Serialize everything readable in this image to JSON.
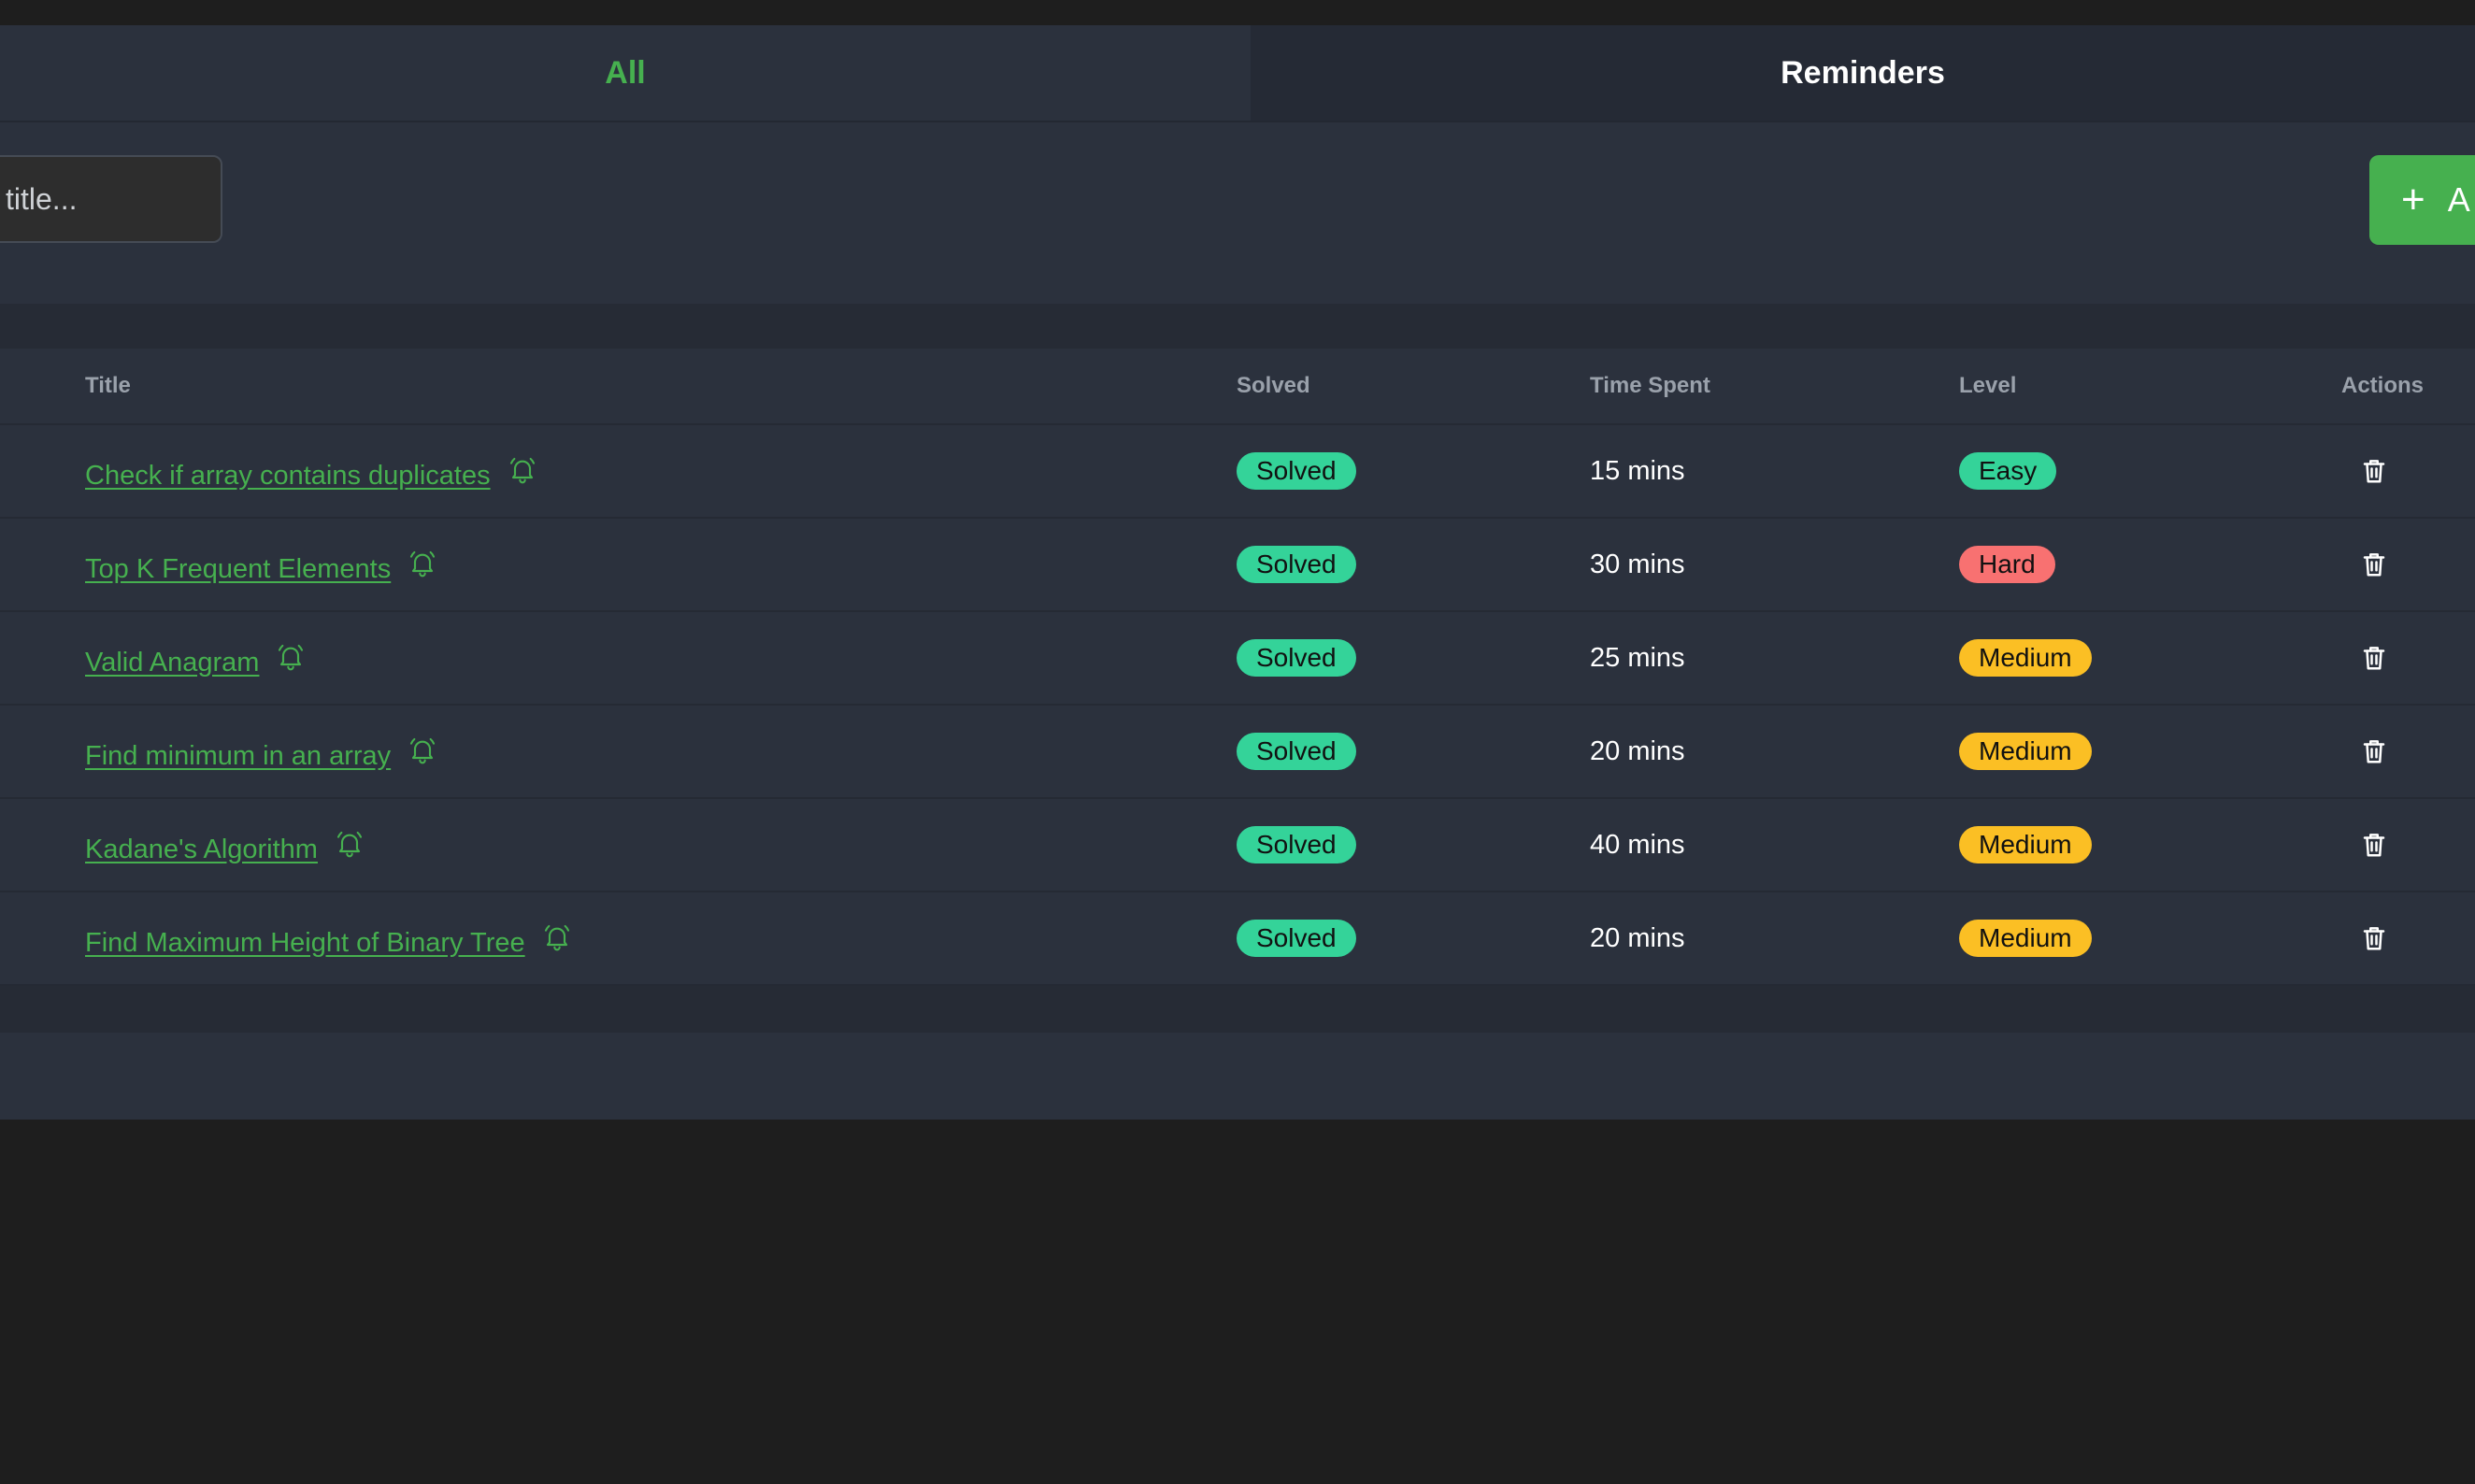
{
  "tabs": [
    {
      "label": "All",
      "active": true
    },
    {
      "label": "Reminders",
      "active": false
    }
  ],
  "search": {
    "placeholder": "Search by title...",
    "visible_placeholder": "title..."
  },
  "add_button": {
    "icon": "plus-icon",
    "label": "A"
  },
  "table": {
    "headers": {
      "title": "Title",
      "solved": "Solved",
      "time": "Time Spent",
      "level": "Level",
      "actions": "Actions"
    },
    "rows": [
      {
        "title": "Check if array contains duplicates",
        "solved": "Solved",
        "time": "15 mins",
        "level": "Easy",
        "level_color": "#34d399"
      },
      {
        "title": "Top K Frequent Elements",
        "solved": "Solved",
        "time": "30 mins",
        "level": "Hard",
        "level_color": "#f87171"
      },
      {
        "title": "Valid Anagram",
        "solved": "Solved",
        "time": "25 mins",
        "level": "Medium",
        "level_color": "#fbbf24"
      },
      {
        "title": "Find minimum in an array",
        "solved": "Solved",
        "time": "20 mins",
        "level": "Medium",
        "level_color": "#fbbf24"
      },
      {
        "title": "Kadane's Algorithm",
        "solved": "Solved",
        "time": "40 mins",
        "level": "Medium",
        "level_color": "#fbbf24"
      },
      {
        "title": "Find Maximum Height of Binary Tree",
        "solved": "Solved",
        "time": "20 mins",
        "level": "Medium",
        "level_color": "#fbbf24"
      }
    ]
  },
  "colors": {
    "accent": "#46b04f",
    "solved_badge": "#34d399",
    "panel_bg": "#2b313d",
    "page_bg": "#1e1e1e"
  }
}
